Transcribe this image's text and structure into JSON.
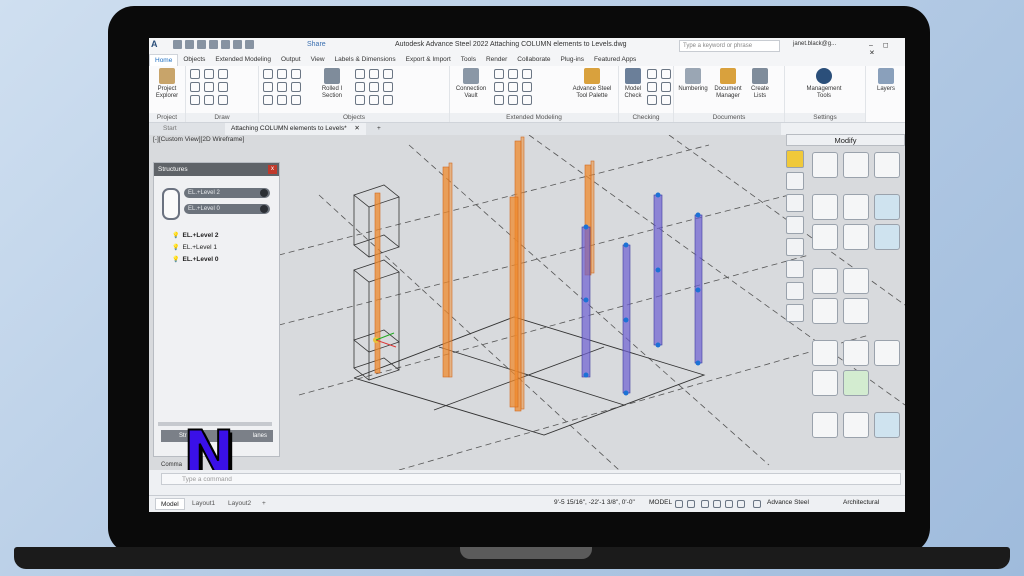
{
  "app": {
    "logo": "A",
    "share_label": "Share",
    "window_title": "Autodesk Advance Steel 2022   Attaching COLUMN elements to Levels.dwg",
    "search_placeholder": "Type a keyword or phrase",
    "user": "janet.black@g...",
    "window_controls": "– ◻ ✕"
  },
  "ribbon_tabs": [
    "Home",
    "Objects",
    "Extended Modeling",
    "Output",
    "View",
    "Labels & Dimensions",
    "Export & Import",
    "Tools",
    "Render",
    "Collaborate",
    "Plug-ins",
    "Featured Apps"
  ],
  "ribbon": {
    "project_explorer": "Project Explorer",
    "project_panel": "Project",
    "draw_panel": "Draw",
    "rolled_section": "Rolled I Section",
    "objects_panel": "Objects",
    "connection_vault": "Connection Vault",
    "advance_steel_tool_palette": "Advance Steel Tool Palette",
    "extended_modeling_panel": "Extended Modeling",
    "model_check": "Model Check",
    "checking_panel": "Checking",
    "numbering": "Numbering",
    "document_manager": "Document Manager",
    "create_lists": "Create Lists",
    "documents_panel": "Documents",
    "management_tools": "Management Tools",
    "settings_panel": "Settings",
    "layers": "Layers"
  },
  "doc_tabs": {
    "start": "Start",
    "active": "Attaching COLUMN elements to Levels*",
    "close": "✕",
    "add": "+"
  },
  "viewport": {
    "label": "[-][Custom View][2D Wireframe]"
  },
  "structures": {
    "title": "Structures",
    "close": "x",
    "pill_top": "EL.+Level 2",
    "pill_bottom": "EL.+Level 0",
    "levels": [
      "EL.+Level 2",
      "EL.+Level 1",
      "EL.+Level 0"
    ],
    "footer_left": "Str",
    "footer_right": "lanes"
  },
  "modify": {
    "title": "Modify"
  },
  "command": {
    "label": "Comma",
    "placeholder": "Type a command"
  },
  "status": {
    "layouts": [
      "Model",
      "Layout1",
      "Layout2"
    ],
    "add": "+",
    "coords": "9'-5 15/16\", -22'-1 3/8\", 0'-0\"",
    "model": "MODEL",
    "advance_steel": "Advance Steel",
    "units": "Architectural"
  },
  "brand": {
    "overlay_letter": "N"
  },
  "colors": {
    "orange_column": "#ef8a2c",
    "blue_column": "#6d5fd1",
    "accent": "#1e6fc2",
    "brand_overlay": "#3a10e8"
  }
}
